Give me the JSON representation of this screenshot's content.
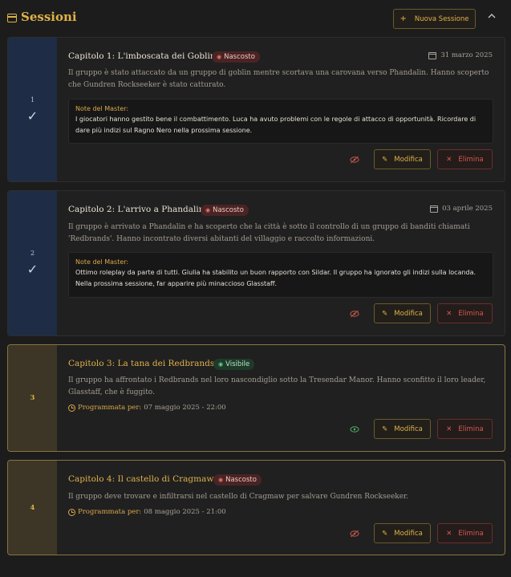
{
  "header": {
    "title": "Sessioni",
    "new_session_label": "Nuova Sessione",
    "new_session_icon": "plus-icon",
    "collapse_icon": "chevron-up-icon"
  },
  "labels": {
    "notes_label": "Note del Master:",
    "scheduled_label": "Programmata per:",
    "edit": "Modifica",
    "delete": "Elimina"
  },
  "sessions": [
    {
      "number": "1",
      "completed": true,
      "title": "Capitolo 1: L'imboscata dei Goblin",
      "status": "Nascosto",
      "date": "31 marzo 2025",
      "description": "Il gruppo è stato attaccato da un gruppo di goblin mentre scortava una carovana verso Phandalin. Hanno scoperto che Gundren Rockseeker è stato catturato.",
      "notes": "I giocatori hanno gestito bene il combattimento. Luca ha avuto problemi con le regole di attacco di opportunità. Ricordare di dare più indizi sul Ragno Nero nella prossima sessione."
    },
    {
      "number": "2",
      "completed": true,
      "title": "Capitolo 2: L'arrivo a Phandalin",
      "status": "Nascosto",
      "date": "03 aprile 2025",
      "description": "Il gruppo è arrivato a Phandalin e ha scoperto che la città è sotto il controllo di un gruppo di banditi chiamati 'Redbrands'. Hanno incontrato diversi abitanti del villaggio e raccolto informazioni.",
      "notes": "Ottimo roleplay da parte di tutti. Giulia ha stabilito un buon rapporto con Sildar. Il gruppo ha ignorato gli indizi sulla locanda. Nella prossima sessione, far apparire più minaccioso Glasstaff."
    },
    {
      "number": "3",
      "completed": false,
      "title": "Capitolo 3: La tana dei Redbrands",
      "status": "Visibile",
      "description": "Il gruppo ha affrontato i Redbrands nel loro nascondiglio sotto la Tresendar Manor. Hanno sconfitto il loro leader, Glasstaff, che è fuggito.",
      "scheduled": "07 maggio 2025 - 22:00"
    },
    {
      "number": "4",
      "completed": false,
      "title": "Capitolo 4: Il castello di Cragmaw",
      "status": "Nascosto",
      "description": "Il gruppo deve trovare e infiltrarsi nel castello di Cragmaw per salvare Gundren Rockseeker.",
      "scheduled": "08 maggio 2025 - 21:00"
    }
  ],
  "colors": {
    "accent": "#e0b14a",
    "hidden_badge": "#4a2424",
    "visible_badge": "#1f3a2a",
    "completed_sidebar": "#1e2d45",
    "upcoming_sidebar": "#3d3626",
    "delete": "#d9584b"
  }
}
